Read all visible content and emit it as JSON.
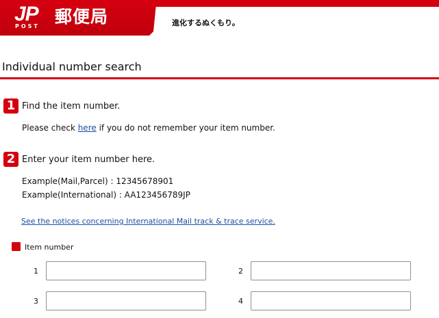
{
  "header": {
    "logo_main": "JP",
    "logo_sub": "POST",
    "brand_title": "郵便局",
    "tagline": "進化するぬくもり。"
  },
  "page_title": "Individual number search",
  "step1": {
    "badge": "1",
    "title": "Find the item number.",
    "help_before": "Please check ",
    "help_link": "here",
    "help_after": " if you do not remember your item number."
  },
  "step2": {
    "badge": "2",
    "title": "Enter your item number here.",
    "example_mail": "Example(Mail,Parcel) : 12345678901",
    "example_international": "Example(International) : AA123456789JP",
    "notices_link": "See the notices concerning International Mail track & trace service."
  },
  "item_number": {
    "label": "Item number",
    "fields": [
      {
        "num": "1",
        "value": ""
      },
      {
        "num": "2",
        "value": ""
      },
      {
        "num": "3",
        "value": ""
      },
      {
        "num": "4",
        "value": ""
      }
    ]
  },
  "colors": {
    "brand_red": "#d4000f",
    "link_blue": "#1a4fa3"
  }
}
